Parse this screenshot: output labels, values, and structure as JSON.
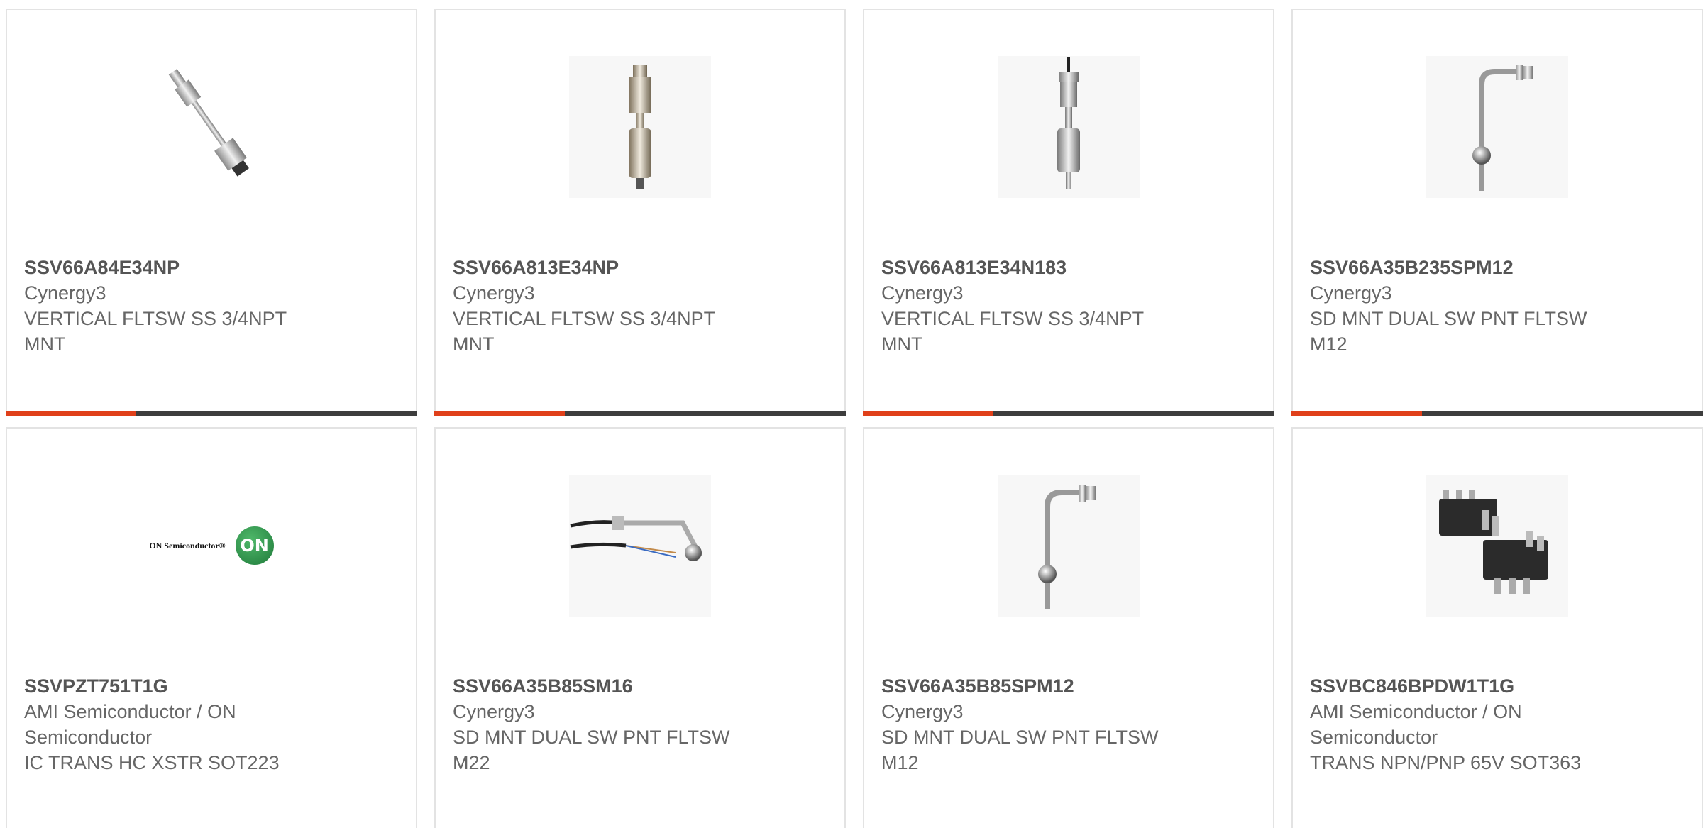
{
  "products": [
    {
      "part_number": "SSV66A84E34NP",
      "manufacturer": "Cynergy3",
      "description": "VERTICAL FLTSW SS 3/4NPT MNT",
      "image_icon": "float-switch-angled-icon"
    },
    {
      "part_number": "SSV66A813E34NP",
      "manufacturer": "Cynergy3",
      "description": "VERTICAL FLTSW SS 3/4NPT MNT",
      "image_icon": "float-switch-vertical-icon"
    },
    {
      "part_number": "SSV66A813E34N183",
      "manufacturer": "Cynergy3",
      "description": "VERTICAL FLTSW SS 3/4NPT MNT",
      "image_icon": "float-switch-cable-icon"
    },
    {
      "part_number": "SSV66A35B235SPM12",
      "manufacturer": "Cynergy3",
      "description": "SD MNT DUAL SW PNT FLTSW M12",
      "image_icon": "float-switch-side-mount-icon"
    },
    {
      "part_number": "SSVPZT751T1G",
      "manufacturer": "AMI Semiconductor / ON Semiconductor",
      "description": "IC TRANS HC XSTR SOT223",
      "image_icon": "on-semiconductor-logo",
      "logo_text": "ON Semiconductor®",
      "logo_badge": "ON"
    },
    {
      "part_number": "SSV66A35B85SM16",
      "manufacturer": "Cynergy3",
      "description": "SD MNT DUAL SW PNT FLTSW M22",
      "image_icon": "float-switch-wired-icon"
    },
    {
      "part_number": "SSV66A35B85SPM12",
      "manufacturer": "Cynergy3",
      "description": "SD MNT DUAL SW PNT FLTSW M12",
      "image_icon": "float-switch-side-mount-icon"
    },
    {
      "part_number": "SSVBC846BPDW1T1G",
      "manufacturer": "AMI Semiconductor / ON Semiconductor",
      "description": "TRANS NPN/PNP 65V SOT363",
      "image_icon": "sot363-chip-icon"
    }
  ],
  "colors": {
    "accent": "#e0401a",
    "bar": "#3d3d3d",
    "border": "#e3e3e3",
    "text": "#666666"
  }
}
